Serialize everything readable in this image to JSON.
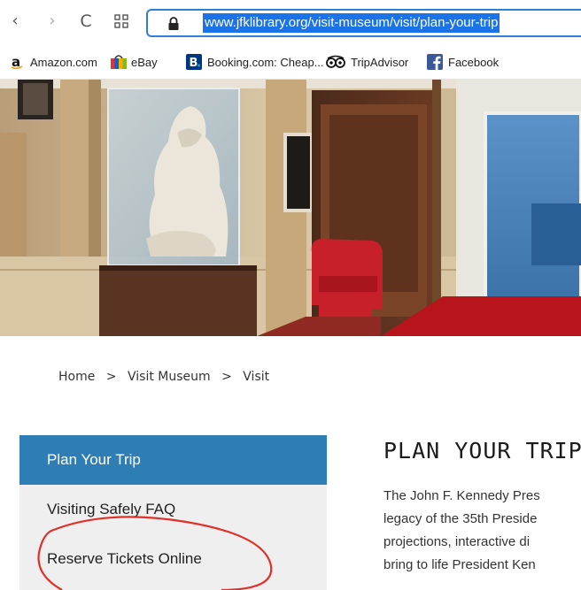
{
  "browser": {
    "url": "www.jfklibrary.org/visit-museum/visit/plan-your-trip",
    "back_icon": "‹",
    "forward_icon": "›",
    "reload_icon": "C",
    "apps_icon": "grid-icon",
    "bookmarks": [
      {
        "label": "Amazon.com",
        "icon": "amazon-icon",
        "color": "#111111"
      },
      {
        "label": "eBay",
        "icon": "ebay-icon",
        "color": "#e53238"
      },
      {
        "label": "Booking.com: Cheap...",
        "icon": "booking-icon",
        "color": "#003580"
      },
      {
        "label": "TripAdvisor",
        "icon": "tripadvisor-icon",
        "color": "#111111"
      },
      {
        "label": "Facebook",
        "icon": "facebook-icon",
        "color": "#3b5998"
      }
    ]
  },
  "hero": {
    "description_icon": "museum-interior-photo"
  },
  "breadcrumb": {
    "home": "Home",
    "sep": ">",
    "visit_museum": "Visit Museum",
    "visit": "Visit"
  },
  "sidebar": {
    "items": [
      {
        "label": "Plan Your Trip",
        "active": true
      },
      {
        "label": "Visiting Safely FAQ",
        "active": false
      },
      {
        "label": "Reserve Tickets Online",
        "active": false
      }
    ]
  },
  "main": {
    "title": "PLAN YOUR TRIP",
    "intro_lines": [
      "The John F. Kennedy Pres",
      "legacy of the 35th Preside",
      "projections, interactive di",
      "bring to life President Ken"
    ]
  },
  "colors": {
    "accent": "#2e7db5",
    "url_highlight": "#1a73e8",
    "annotation": "#e0302a"
  }
}
